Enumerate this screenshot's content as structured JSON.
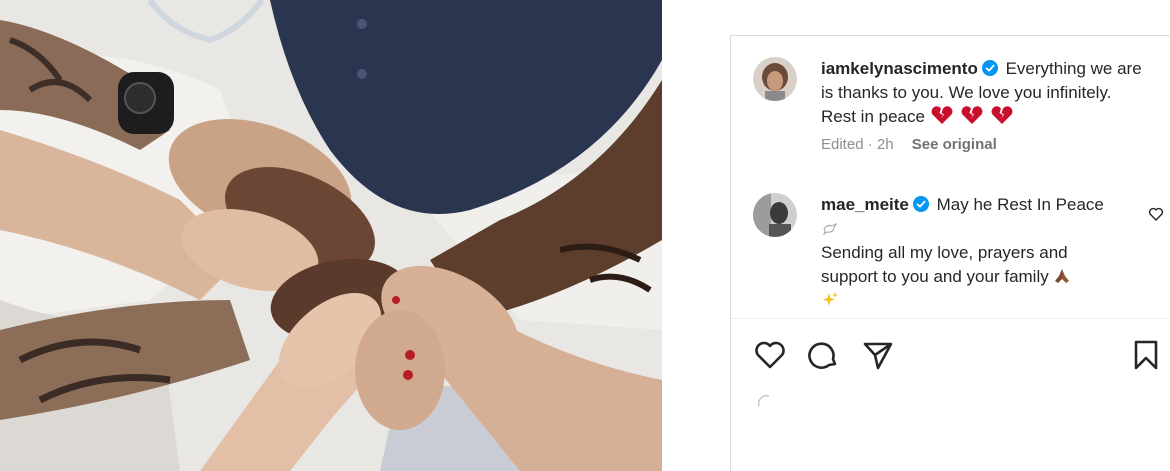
{
  "post": {
    "image_alt": "Several people stacking their hands together over a hospital bed"
  },
  "comments": [
    {
      "username": "iamkelynascimento",
      "verified": true,
      "text": "Everything we are is thanks to you. We love you infinitely. Rest in peace",
      "emoji": [
        "broken-heart-emoji",
        "broken-heart-emoji",
        "broken-heart-emoji"
      ],
      "edited_time": "Edited · 2h",
      "see_original": "See original"
    },
    {
      "username": "mae_meite",
      "verified": true,
      "text_line1": "May he Rest In Peace",
      "emoji_line2": "dove-emoji",
      "text_line3": "Sending all my love, prayers and support to you and your family",
      "emoji_end": [
        "praying-hands-emoji",
        "sparkles-emoji"
      ]
    }
  ],
  "actions": [
    "like-icon",
    "comment-icon",
    "share-icon",
    "save-icon"
  ],
  "colors": {
    "verified": "#0095f6",
    "heart": "#c8102e",
    "text": "#262626",
    "muted": "#8e8e8e"
  }
}
